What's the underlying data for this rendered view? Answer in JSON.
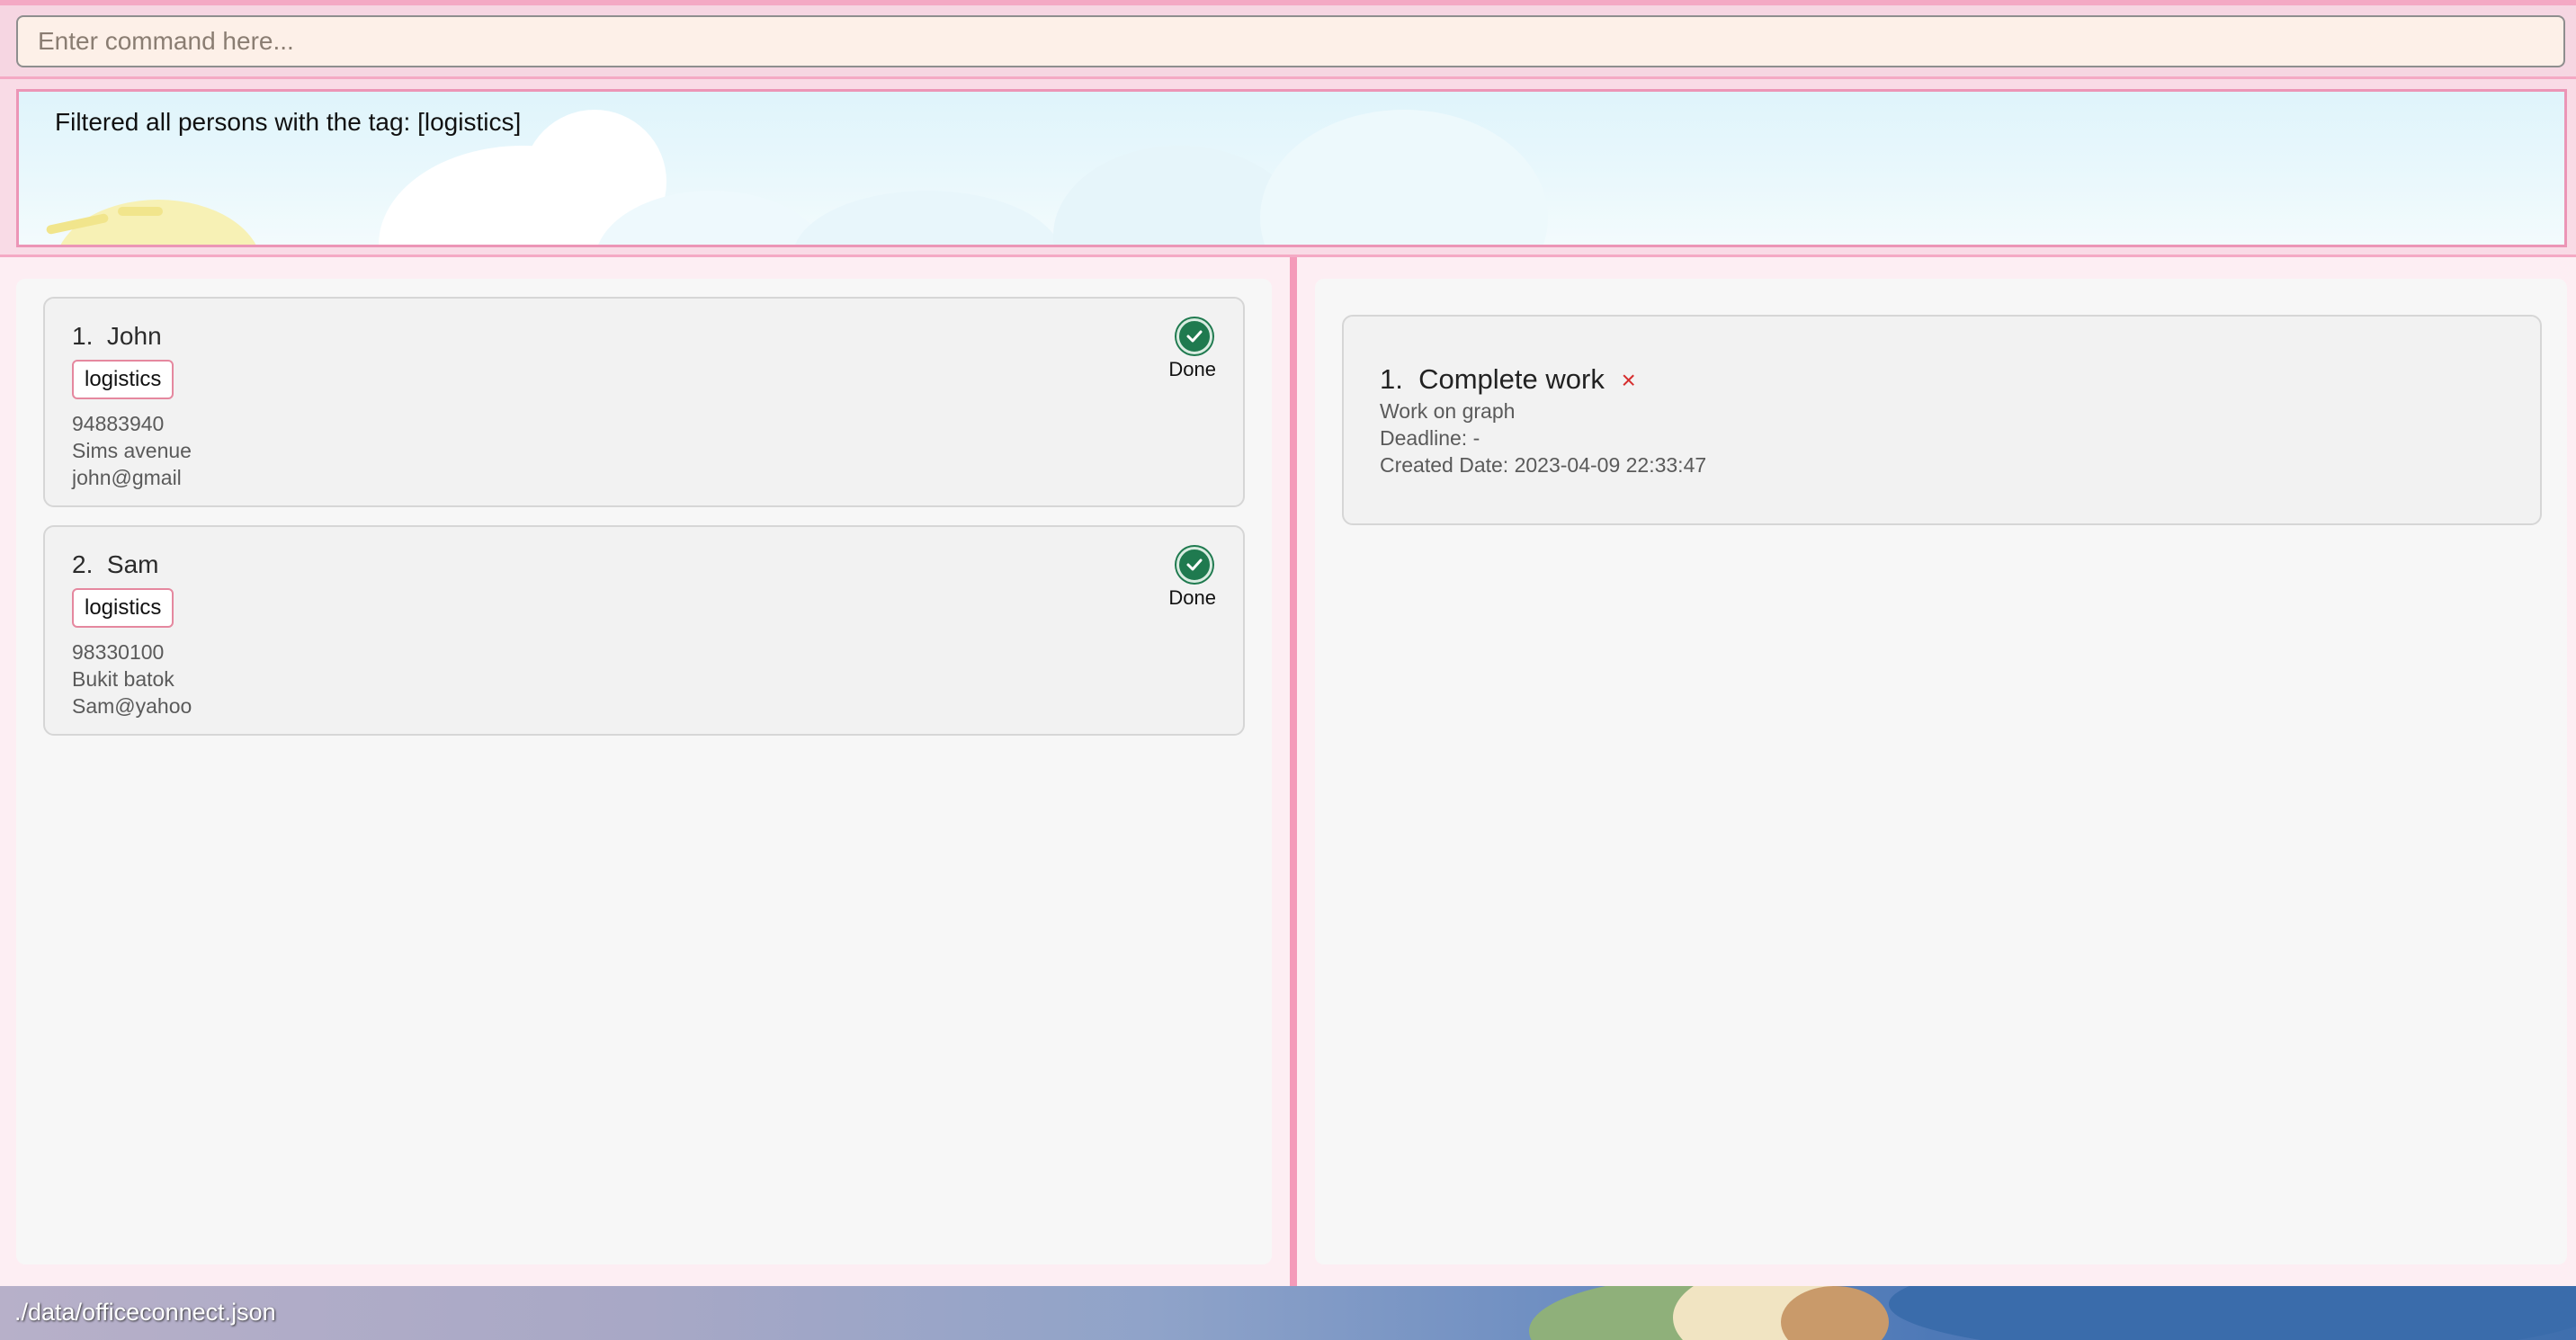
{
  "command": {
    "placeholder": "Enter command here...",
    "value": ""
  },
  "result": {
    "message": "Filtered all persons with the tag: [logistics]"
  },
  "persons": [
    {
      "index": "1.",
      "name": "John",
      "tags": [
        "logistics"
      ],
      "phone": "94883940",
      "address": "Sims avenue",
      "email": "john@gmail",
      "status_label": "Done",
      "status_icon": "check-circle-icon"
    },
    {
      "index": "2.",
      "name": "Sam",
      "tags": [
        "logistics"
      ],
      "phone": "98330100",
      "address": "Bukit batok",
      "email": "Sam@yahoo",
      "status_label": "Done",
      "status_icon": "check-circle-icon"
    }
  ],
  "tasks": [
    {
      "index": "1.",
      "title": "Complete work",
      "status_mark": "×",
      "description": "Work on graph",
      "deadline": "Deadline: -",
      "created": "Created Date: 2023-04-09 22:33:47"
    }
  ],
  "statusbar": {
    "path": "./data/officeconnect.json"
  },
  "colors": {
    "accent_pink": "#f49ab9",
    "done_green": "#1f7a4f",
    "not_done_red": "#d62e2e"
  }
}
